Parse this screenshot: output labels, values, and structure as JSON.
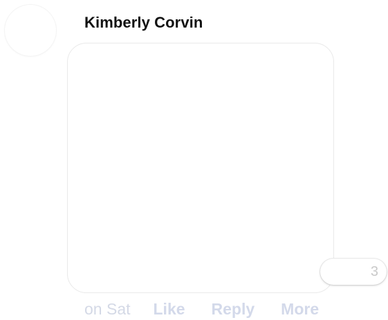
{
  "author": {
    "name": "Kimberly Corvin"
  },
  "reactions": {
    "count": "3"
  },
  "meta": {
    "timestamp": "on Sat",
    "actions": {
      "like": "Like",
      "reply": "Reply",
      "more": "More"
    }
  }
}
